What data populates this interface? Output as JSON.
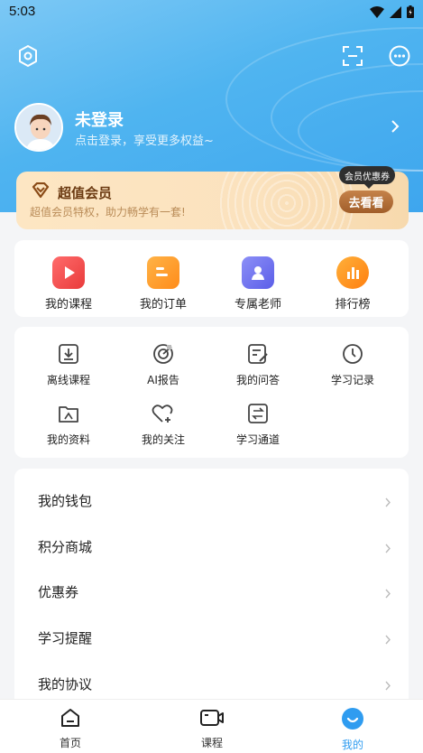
{
  "status_bar": {
    "time": "5:03"
  },
  "profile": {
    "name": "未登录",
    "subtitle": "点击登录，享受更多权益~"
  },
  "vip": {
    "title": "超值会员",
    "desc": "超值会员特权，助力畅学有一套!",
    "button": "去看看",
    "tip": "会员优惠券"
  },
  "quick": [
    {
      "label": "我的课程",
      "icon": "play-icon",
      "color": "#f04a4a"
    },
    {
      "label": "我的订单",
      "icon": "order-icon",
      "color": "#ff9c2e"
    },
    {
      "label": "专属老师",
      "icon": "teacher-icon",
      "color": "#6a6df2"
    },
    {
      "label": "排行榜",
      "icon": "rank-icon",
      "color": "#ff8e1e"
    }
  ],
  "services": [
    {
      "label": "离线课程",
      "icon": "download-icon"
    },
    {
      "label": "AI报告",
      "icon": "ai-report-icon"
    },
    {
      "label": "我的问答",
      "icon": "qa-icon"
    },
    {
      "label": "学习记录",
      "icon": "clock-icon"
    },
    {
      "label": "我的资料",
      "icon": "folder-icon"
    },
    {
      "label": "我的关注",
      "icon": "heart-plus-icon"
    },
    {
      "label": "学习通道",
      "icon": "channel-icon"
    }
  ],
  "menu": [
    "我的钱包",
    "积分商城",
    "优惠券",
    "学习提醒",
    "我的协议"
  ],
  "tabs": [
    {
      "label": "首页",
      "icon": "home-icon"
    },
    {
      "label": "课程",
      "icon": "video-icon"
    },
    {
      "label": "我的",
      "icon": "smile-icon"
    }
  ],
  "colors": {
    "accent": "#2f9cf0",
    "vip_text": "#6b3a12"
  }
}
